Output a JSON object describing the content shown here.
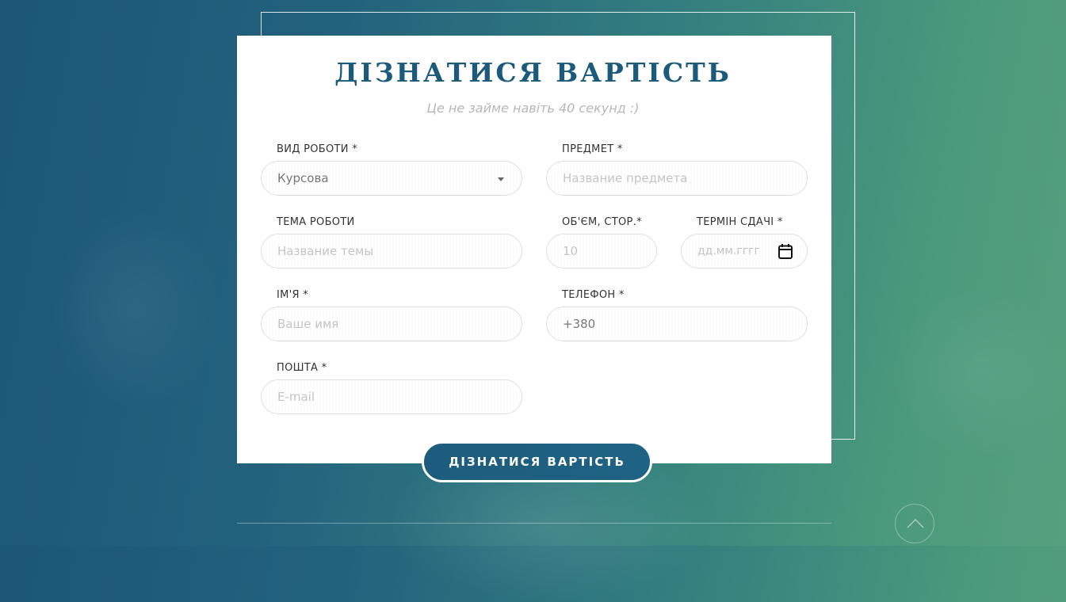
{
  "form": {
    "title": "ДІЗНАТИСЯ ВАРТІСТЬ",
    "subtitle": "Це не займе навіть 40 секунд :)",
    "fields": {
      "work_type": {
        "label": "ВИД РОБОТИ *",
        "value": "Курсова"
      },
      "subject": {
        "label": "ПРЕДМЕТ *",
        "placeholder": "Название предмета"
      },
      "topic": {
        "label": "ТЕМА РОБОТИ",
        "placeholder": "Название темы"
      },
      "volume": {
        "label": "ОБ'ЄМ, СТОР.*",
        "placeholder": "10"
      },
      "deadline": {
        "label": "ТЕРМІН СДАЧІ *",
        "placeholder": "дд.мм.гггг",
        "icon": "calendar-icon"
      },
      "name": {
        "label": "ІМ'Я *",
        "placeholder": "Ваше имя"
      },
      "phone": {
        "label": "ТЕЛЕФОН *",
        "value": "+380"
      },
      "email": {
        "label": "ПОШТА *",
        "placeholder": "E-mail"
      }
    },
    "submit_label": "ДІЗНАТИСЯ ВАРТІСТЬ"
  },
  "scroll_top": {
    "icon": "chevron-up-icon"
  },
  "colors": {
    "accent": "#1c5a7c",
    "background_start": "#1b5676",
    "background_end": "#55a07e",
    "subtitle": "#b7b7b7",
    "placeholder": "#c4c4c4"
  }
}
